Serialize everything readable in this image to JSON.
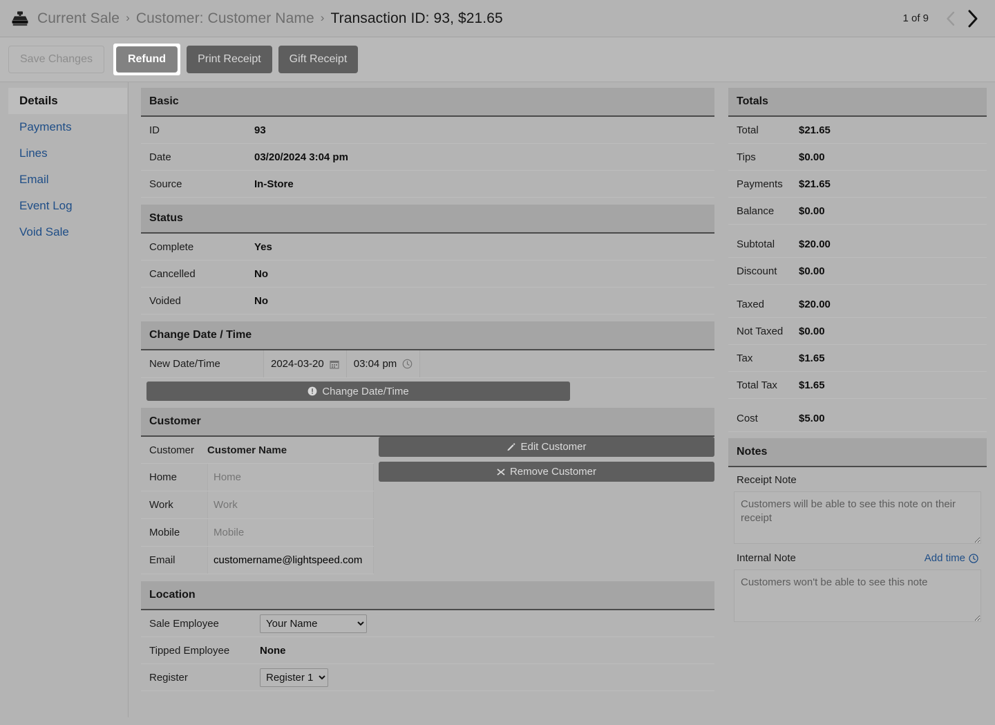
{
  "header": {
    "icon": "cash-register-icon",
    "breadcrumb": [
      {
        "label": "Current Sale",
        "active": false
      },
      {
        "label": "Customer: Customer Name",
        "active": false
      },
      {
        "label": "Transaction ID: 93, $21.65",
        "active": true
      }
    ],
    "separator": "›",
    "pager": {
      "label": "1 of 9",
      "prev_icon": "chevron-left-icon",
      "next_icon": "chevron-right-icon"
    }
  },
  "toolbar": {
    "save_label": "Save Changes",
    "refund_label": "Refund",
    "print_receipt_label": "Print Receipt",
    "gift_receipt_label": "Gift Receipt"
  },
  "sidebar": {
    "items": [
      {
        "label": "Details",
        "active": true
      },
      {
        "label": "Payments",
        "active": false
      },
      {
        "label": "Lines",
        "active": false
      },
      {
        "label": "Email",
        "active": false
      },
      {
        "label": "Event Log",
        "active": false
      },
      {
        "label": "Void Sale",
        "active": false
      }
    ]
  },
  "basic": {
    "title": "Basic",
    "rows": [
      {
        "label": "ID",
        "value": "93"
      },
      {
        "label": "Date",
        "value": "03/20/2024 3:04 pm"
      },
      {
        "label": "Source",
        "value": "In-Store"
      }
    ]
  },
  "status": {
    "title": "Status",
    "rows": [
      {
        "label": "Complete",
        "value": "Yes"
      },
      {
        "label": "Cancelled",
        "value": "No"
      },
      {
        "label": "Voided",
        "value": "No"
      }
    ]
  },
  "change_datetime": {
    "title": "Change Date / Time",
    "row_label": "New Date/Time",
    "date_value": "2024-03-20",
    "date_icon": "calendar-icon",
    "time_value": "03:04 pm",
    "time_icon": "clock-icon",
    "button_label": "Change Date/Time",
    "button_icon": "exclamation-circle-icon"
  },
  "customer": {
    "title": "Customer",
    "name_label": "Customer",
    "name_value": "Customer Name",
    "fields": [
      {
        "label": "Home",
        "value": "",
        "placeholder": "Home"
      },
      {
        "label": "Work",
        "value": "",
        "placeholder": "Work"
      },
      {
        "label": "Mobile",
        "value": "",
        "placeholder": "Mobile"
      },
      {
        "label": "Email",
        "value": "customername@lightspeed.com",
        "placeholder": "Email"
      }
    ],
    "edit_label": "Edit Customer",
    "edit_icon": "pencil-icon",
    "remove_label": "Remove Customer",
    "remove_icon": "x-mark-icon"
  },
  "location": {
    "title": "Location",
    "sale_employee_label": "Sale Employee",
    "sale_employee_value": "Your Name",
    "tipped_employee_label": "Tipped Employee",
    "tipped_employee_value": "None",
    "register_label": "Register",
    "register_value": "Register 1"
  },
  "totals": {
    "title": "Totals",
    "groups": [
      [
        {
          "label": "Total",
          "value": "$21.65"
        },
        {
          "label": "Tips",
          "value": "$0.00"
        },
        {
          "label": "Payments",
          "value": "$21.65"
        },
        {
          "label": "Balance",
          "value": "$0.00"
        }
      ],
      [
        {
          "label": "Subtotal",
          "value": "$20.00"
        },
        {
          "label": "Discount",
          "value": "$0.00"
        }
      ],
      [
        {
          "label": "Taxed",
          "value": "$20.00"
        },
        {
          "label": "Not Taxed",
          "value": "$0.00"
        },
        {
          "label": "Tax",
          "value": "$1.65"
        },
        {
          "label": "Total Tax",
          "value": "$1.65"
        }
      ],
      [
        {
          "label": "Cost",
          "value": "$5.00"
        }
      ]
    ]
  },
  "notes": {
    "title": "Notes",
    "receipt_note_label": "Receipt Note",
    "receipt_note_value": "",
    "receipt_note_placeholder": "Customers will be able to see this note on their receipt",
    "internal_note_label": "Internal Note",
    "internal_note_value": "",
    "internal_note_placeholder": "Customers won't be able to see this note",
    "add_time_label": "Add time",
    "add_time_icon": "clock-icon"
  },
  "colors": {
    "page_bg": "#b4b4b4",
    "panel_head_bg": "#a5a5a5",
    "dark_button": "#5e5e5e",
    "link_blue": "#1f4e87",
    "focus_ring": "#ffffff"
  }
}
